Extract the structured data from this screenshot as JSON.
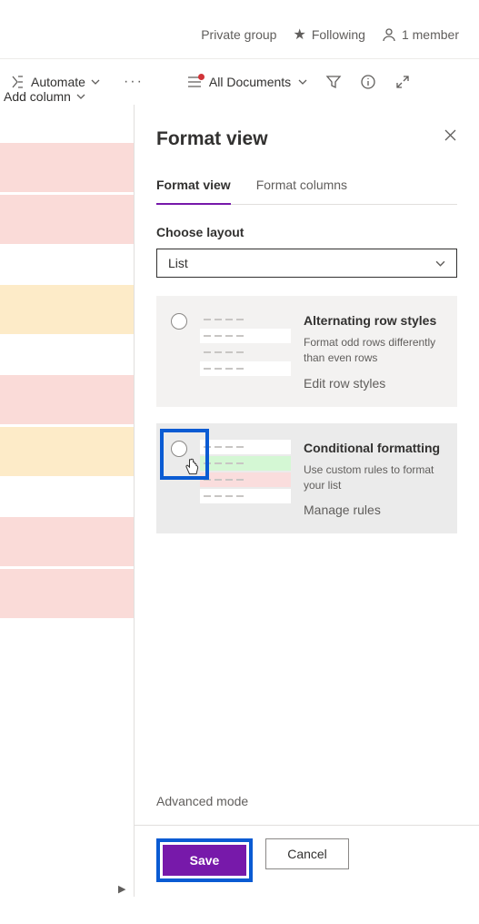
{
  "header": {
    "group_text": "Private group",
    "following_text": "Following",
    "member_text": "1 member"
  },
  "toolbar": {
    "automate_label": "Automate",
    "views_label": "All Documents"
  },
  "list": {
    "add_column_label": "Add column"
  },
  "panel": {
    "title": "Format view",
    "tabs": {
      "format_view": "Format view",
      "format_columns": "Format columns"
    },
    "choose_layout_label": "Choose layout",
    "layout_value": "List",
    "card1": {
      "title": "Alternating row styles",
      "desc": "Format odd rows differently than even rows",
      "link": "Edit row styles"
    },
    "card2": {
      "title": "Conditional formatting",
      "desc": "Use custom rules to format your list",
      "link": "Manage rules"
    },
    "advanced_link": "Advanced mode",
    "save_label": "Save",
    "cancel_label": "Cancel"
  }
}
